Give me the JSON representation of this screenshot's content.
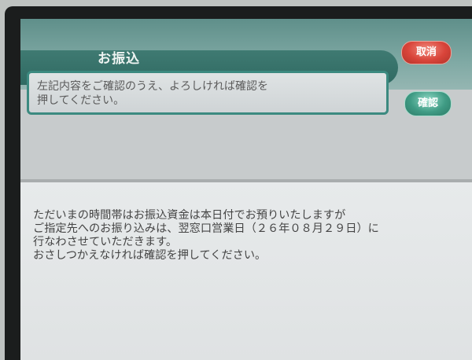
{
  "header": {
    "title": "お振込"
  },
  "instruction": {
    "text": "左記内容をご確認のうえ、よろしければ確認を\n押してください。"
  },
  "buttons": {
    "cancel_label": "取消",
    "confirm_label": "確認"
  },
  "message": {
    "text": "ただいまの時間帯はお振込資金は本日付でお預りいたしますが\nご指定先へのお振り込みは、翌窓口営業日（２６年０８月２９日）に\n行なわさせていただきます。\nおさしつかえなければ確認を押してください。"
  },
  "colors": {
    "accent_green": "#3c8a80",
    "cancel_red": "#d9443a",
    "confirm_green": "#3f9b84"
  }
}
